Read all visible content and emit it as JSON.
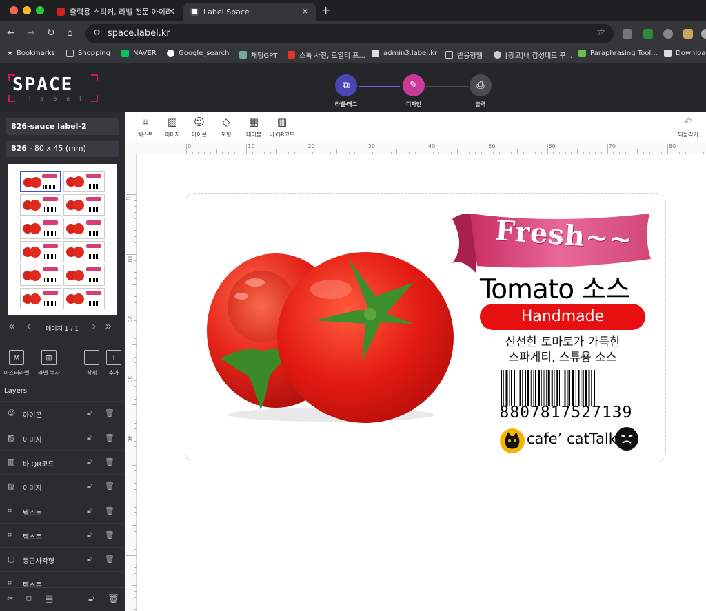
{
  "browser": {
    "tabs": [
      {
        "title": "출력용 스티커, 라벨 전문 아이라벨"
      },
      {
        "title": "Label Space"
      }
    ],
    "url": "space.label.kr",
    "bookmarks": [
      "Bookmarks",
      "Shopping",
      "NAVER",
      "Google_search",
      "채팅GPT",
      "스톡 사진, 로열티 프...",
      "admin3.label.kr",
      "반응형웹",
      "[광고]내 감성대로 꾸...",
      "Paraphrasing Tool...",
      "Download"
    ]
  },
  "app": {
    "logo": "SPACE",
    "logo_sub": "label",
    "steps": [
      {
        "label": "라벨·태그"
      },
      {
        "label": "디자인"
      },
      {
        "label": "출력"
      }
    ]
  },
  "sidebar": {
    "label_name": "826-sauce label-2",
    "size_code": "826",
    "size_text": " - 80 x 45 (mm)",
    "page_text": "페이지 1 / 1",
    "tools": [
      "마스터라벨",
      "라벨 복사",
      "삭제",
      "추가"
    ],
    "layers_title": "Layers",
    "layers": [
      "아이콘",
      "이미지",
      "바,QR코드",
      "이미지",
      "텍스트",
      "텍스트",
      "둥근사각형",
      "텍스트"
    ]
  },
  "toolbar": {
    "items": [
      "텍스트",
      "이미지",
      "아이콘",
      "도형",
      "테이블",
      "바 QR코드"
    ],
    "undo": "되돌리기"
  },
  "ruler": {
    "h": [
      "0",
      "10",
      "20",
      "30",
      "40",
      "50",
      "60",
      "70",
      "80"
    ],
    "v": [
      "0",
      "10",
      "20",
      "30",
      "40"
    ]
  },
  "label": {
    "ribbon": "Fresh~~",
    "title": "Tomato 소스",
    "badge": "Handmade",
    "desc1": "신선한 토마토가 가득한",
    "desc2": "스파게티, 스튜용 소스",
    "barcode": "8807817527139",
    "brand": "cafe’ catTalk"
  },
  "colors": {
    "accent_step": "#4b46b8",
    "accent_design": "#c93a9a",
    "badge_red": "#e80f11",
    "ribbon_pink": "#d63f74"
  }
}
